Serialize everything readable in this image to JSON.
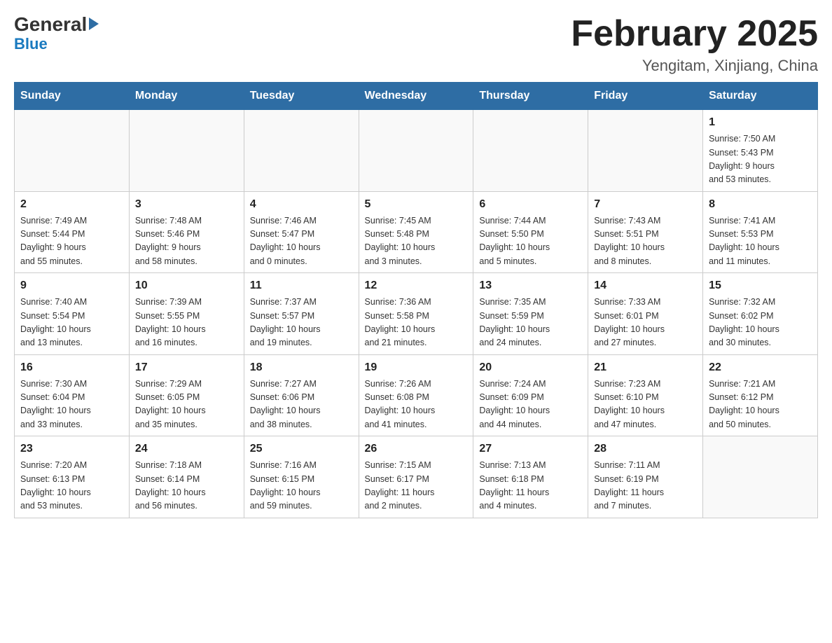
{
  "logo": {
    "general": "General",
    "blue": "Blue",
    "arrow": "▶"
  },
  "title": "February 2025",
  "subtitle": "Yengitam, Xinjiang, China",
  "days_of_week": [
    "Sunday",
    "Monday",
    "Tuesday",
    "Wednesday",
    "Thursday",
    "Friday",
    "Saturday"
  ],
  "weeks": [
    [
      {
        "day": "",
        "info": ""
      },
      {
        "day": "",
        "info": ""
      },
      {
        "day": "",
        "info": ""
      },
      {
        "day": "",
        "info": ""
      },
      {
        "day": "",
        "info": ""
      },
      {
        "day": "",
        "info": ""
      },
      {
        "day": "1",
        "info": "Sunrise: 7:50 AM\nSunset: 5:43 PM\nDaylight: 9 hours\nand 53 minutes."
      }
    ],
    [
      {
        "day": "2",
        "info": "Sunrise: 7:49 AM\nSunset: 5:44 PM\nDaylight: 9 hours\nand 55 minutes."
      },
      {
        "day": "3",
        "info": "Sunrise: 7:48 AM\nSunset: 5:46 PM\nDaylight: 9 hours\nand 58 minutes."
      },
      {
        "day": "4",
        "info": "Sunrise: 7:46 AM\nSunset: 5:47 PM\nDaylight: 10 hours\nand 0 minutes."
      },
      {
        "day": "5",
        "info": "Sunrise: 7:45 AM\nSunset: 5:48 PM\nDaylight: 10 hours\nand 3 minutes."
      },
      {
        "day": "6",
        "info": "Sunrise: 7:44 AM\nSunset: 5:50 PM\nDaylight: 10 hours\nand 5 minutes."
      },
      {
        "day": "7",
        "info": "Sunrise: 7:43 AM\nSunset: 5:51 PM\nDaylight: 10 hours\nand 8 minutes."
      },
      {
        "day": "8",
        "info": "Sunrise: 7:41 AM\nSunset: 5:53 PM\nDaylight: 10 hours\nand 11 minutes."
      }
    ],
    [
      {
        "day": "9",
        "info": "Sunrise: 7:40 AM\nSunset: 5:54 PM\nDaylight: 10 hours\nand 13 minutes."
      },
      {
        "day": "10",
        "info": "Sunrise: 7:39 AM\nSunset: 5:55 PM\nDaylight: 10 hours\nand 16 minutes."
      },
      {
        "day": "11",
        "info": "Sunrise: 7:37 AM\nSunset: 5:57 PM\nDaylight: 10 hours\nand 19 minutes."
      },
      {
        "day": "12",
        "info": "Sunrise: 7:36 AM\nSunset: 5:58 PM\nDaylight: 10 hours\nand 21 minutes."
      },
      {
        "day": "13",
        "info": "Sunrise: 7:35 AM\nSunset: 5:59 PM\nDaylight: 10 hours\nand 24 minutes."
      },
      {
        "day": "14",
        "info": "Sunrise: 7:33 AM\nSunset: 6:01 PM\nDaylight: 10 hours\nand 27 minutes."
      },
      {
        "day": "15",
        "info": "Sunrise: 7:32 AM\nSunset: 6:02 PM\nDaylight: 10 hours\nand 30 minutes."
      }
    ],
    [
      {
        "day": "16",
        "info": "Sunrise: 7:30 AM\nSunset: 6:04 PM\nDaylight: 10 hours\nand 33 minutes."
      },
      {
        "day": "17",
        "info": "Sunrise: 7:29 AM\nSunset: 6:05 PM\nDaylight: 10 hours\nand 35 minutes."
      },
      {
        "day": "18",
        "info": "Sunrise: 7:27 AM\nSunset: 6:06 PM\nDaylight: 10 hours\nand 38 minutes."
      },
      {
        "day": "19",
        "info": "Sunrise: 7:26 AM\nSunset: 6:08 PM\nDaylight: 10 hours\nand 41 minutes."
      },
      {
        "day": "20",
        "info": "Sunrise: 7:24 AM\nSunset: 6:09 PM\nDaylight: 10 hours\nand 44 minutes."
      },
      {
        "day": "21",
        "info": "Sunrise: 7:23 AM\nSunset: 6:10 PM\nDaylight: 10 hours\nand 47 minutes."
      },
      {
        "day": "22",
        "info": "Sunrise: 7:21 AM\nSunset: 6:12 PM\nDaylight: 10 hours\nand 50 minutes."
      }
    ],
    [
      {
        "day": "23",
        "info": "Sunrise: 7:20 AM\nSunset: 6:13 PM\nDaylight: 10 hours\nand 53 minutes."
      },
      {
        "day": "24",
        "info": "Sunrise: 7:18 AM\nSunset: 6:14 PM\nDaylight: 10 hours\nand 56 minutes."
      },
      {
        "day": "25",
        "info": "Sunrise: 7:16 AM\nSunset: 6:15 PM\nDaylight: 10 hours\nand 59 minutes."
      },
      {
        "day": "26",
        "info": "Sunrise: 7:15 AM\nSunset: 6:17 PM\nDaylight: 11 hours\nand 2 minutes."
      },
      {
        "day": "27",
        "info": "Sunrise: 7:13 AM\nSunset: 6:18 PM\nDaylight: 11 hours\nand 4 minutes."
      },
      {
        "day": "28",
        "info": "Sunrise: 7:11 AM\nSunset: 6:19 PM\nDaylight: 11 hours\nand 7 minutes."
      },
      {
        "day": "",
        "info": ""
      }
    ]
  ]
}
